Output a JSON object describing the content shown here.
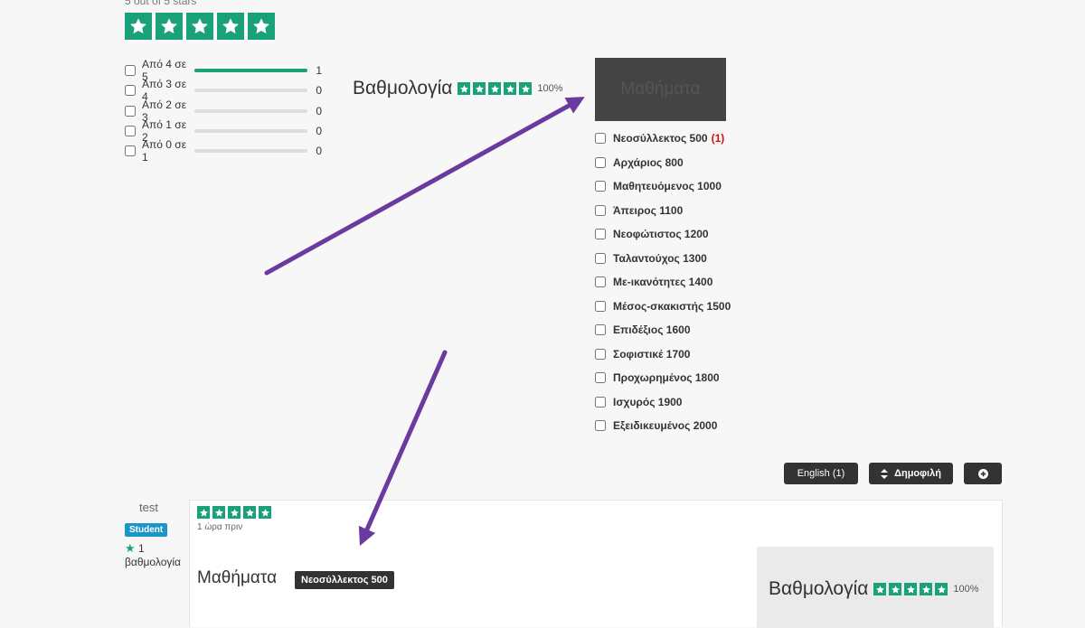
{
  "top": {
    "caption": "5 out of 5 stars",
    "stars": 5
  },
  "rating_filter": [
    {
      "label": "Από 4 σε 5",
      "count": "1",
      "fill": 1.0
    },
    {
      "label": "Από 3 σε 4",
      "count": "0",
      "fill": 0
    },
    {
      "label": "Από 2 σε 3",
      "count": "0",
      "fill": 0
    },
    {
      "label": "Από 1 σε 2",
      "count": "0",
      "fill": 0
    },
    {
      "label": "Από 0 σε 1",
      "count": "0",
      "fill": 0
    }
  ],
  "overall": {
    "title": "Βαθμολογία",
    "percent": "100%"
  },
  "courses": {
    "title": "Μαθήματα",
    "items": [
      {
        "label": "Νεοσύλλεκτος 500",
        "count": "(1)"
      },
      {
        "label": "Αρχάριος 800",
        "count": ""
      },
      {
        "label": "Μαθητευόμενος 1000",
        "count": ""
      },
      {
        "label": "Άπειρος 1100",
        "count": ""
      },
      {
        "label": "Νεοφώτιστος 1200",
        "count": ""
      },
      {
        "label": "Ταλαντούχος 1300",
        "count": ""
      },
      {
        "label": "Με-ικανότητες 1400",
        "count": ""
      },
      {
        "label": "Μέσος-σκακιστής 1500",
        "count": ""
      },
      {
        "label": "Επιδέξιος 1600",
        "count": ""
      },
      {
        "label": "Σοφιστικέ 1700",
        "count": ""
      },
      {
        "label": "Προχωρημένος 1800",
        "count": ""
      },
      {
        "label": "Ισχυρός 1900",
        "count": ""
      },
      {
        "label": "Εξειδικευμένος 2000",
        "count": ""
      }
    ]
  },
  "toolbar": {
    "language_label": "English (1)",
    "sort_icon": "sort-icon",
    "sort_label": "Δημοφιλή",
    "add_icon": "plus-circle-icon"
  },
  "review": {
    "reviewer_name": "test",
    "badge": "Student",
    "review_count": "1",
    "review_count_label": "βαθμολογία",
    "stars": 5,
    "time": "1 ώρα πριν",
    "course_title": "Μαθήματα",
    "course_tag": "Νεοσύλλεκτος 500",
    "rating_title": "Βαθμολογία",
    "rating_percent": "100%"
  },
  "colors": {
    "star_green": "#1aa179",
    "annotation_arrow": "#6b3a9e",
    "badge_blue": "#1b96c9"
  }
}
